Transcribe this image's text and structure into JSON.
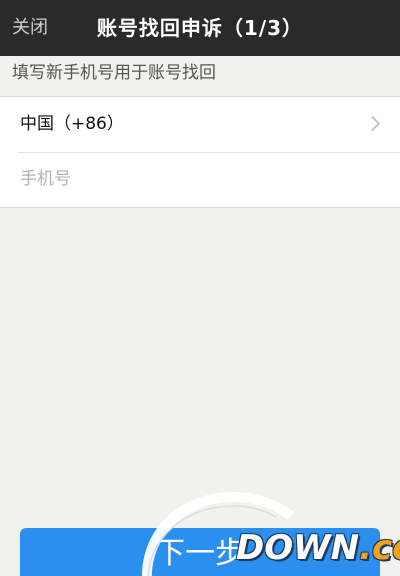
{
  "navbar": {
    "close_label": "关闭",
    "title": "账号找回申诉（1/3）"
  },
  "section": {
    "header": "填写新手机号用于账号找回"
  },
  "form": {
    "country_label": "中国（+86）",
    "phone_placeholder": "手机号",
    "phone_value": ""
  },
  "actions": {
    "next_label": "下一步"
  },
  "watermark": {
    "text_main": "DOWN",
    "text_dot": ".",
    "text_suffix": "cc"
  },
  "colors": {
    "navbar_bg": "#2a2a2a",
    "primary_button": "#2b8ff0",
    "page_bg": "#f1f1ed"
  }
}
